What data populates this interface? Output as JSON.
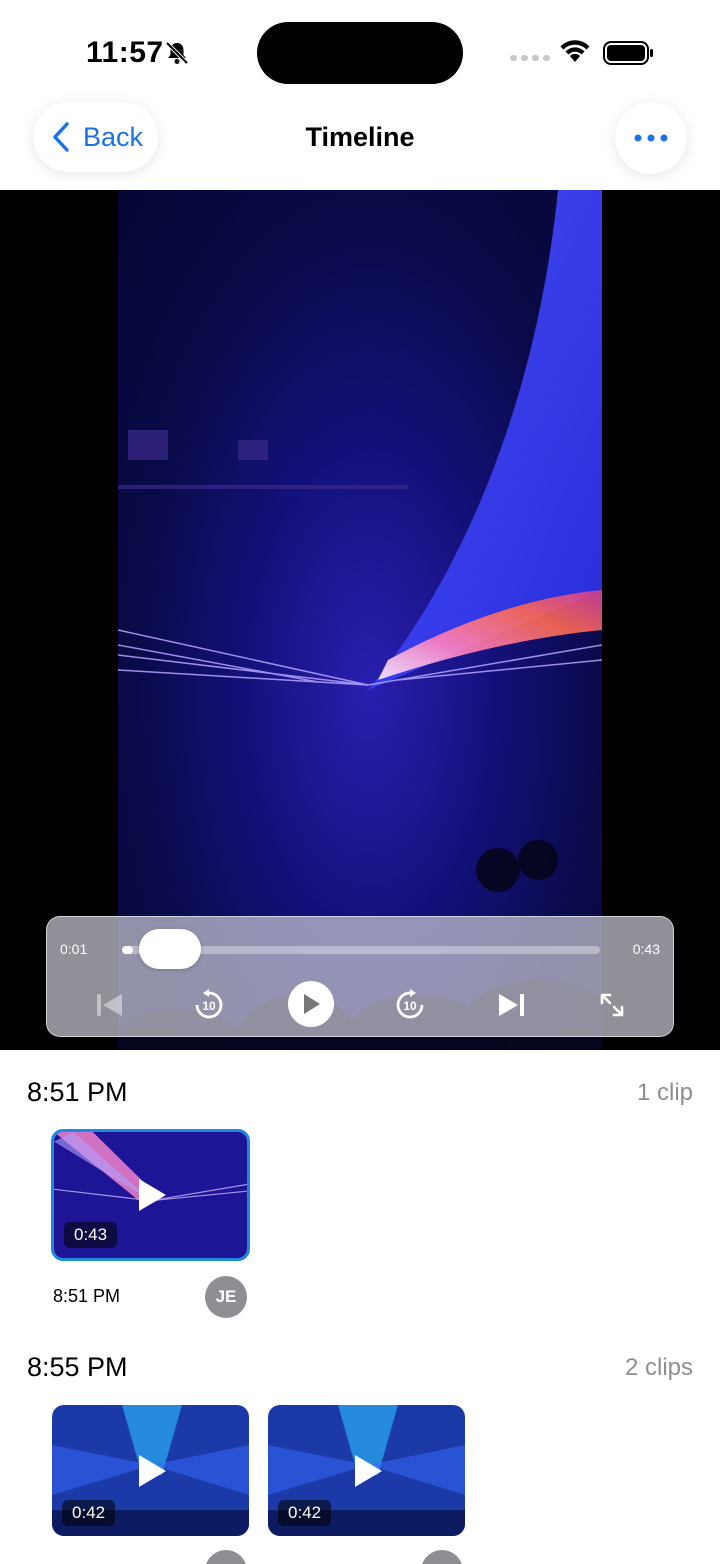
{
  "status_bar": {
    "time": "11:57"
  },
  "nav": {
    "back_label": "Back",
    "title": "Timeline"
  },
  "player": {
    "current_time": "0:01",
    "total_time": "0:43",
    "progress": 0.023,
    "skip_back_label": "10",
    "skip_forward_label": "10"
  },
  "sections": [
    {
      "time": "8:51 PM",
      "count": "1 clip",
      "clips": [
        {
          "duration": "0:43",
          "time": "8:51 PM",
          "avatar": "JE",
          "selected": true
        }
      ]
    },
    {
      "time": "8:55 PM",
      "count": "2 clips",
      "clips": [
        {
          "duration": "0:42"
        },
        {
          "duration": "0:42"
        }
      ]
    }
  ],
  "colors": {
    "accent": "#1a73e8",
    "selected_border": "#1e88e5",
    "secondary_text": "#8e8e93"
  }
}
